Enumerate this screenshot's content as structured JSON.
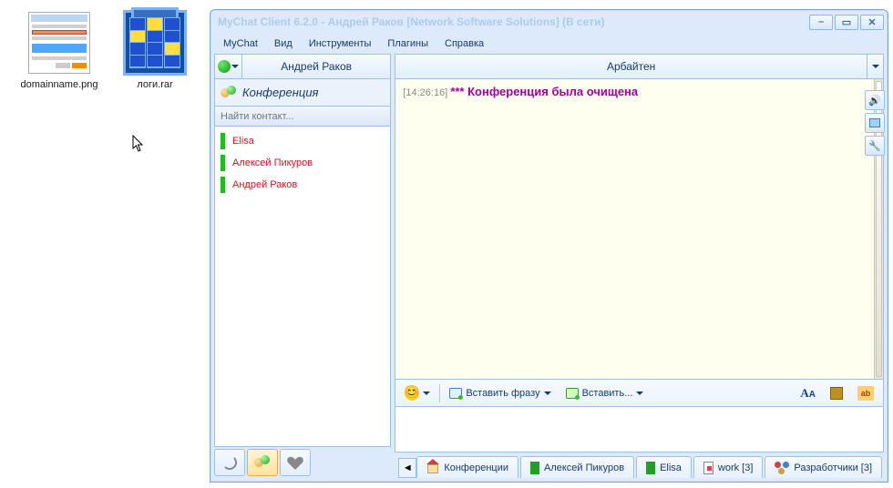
{
  "desktop": {
    "icons": [
      {
        "label": "domainname.png"
      },
      {
        "label": "логи.rar"
      }
    ]
  },
  "window": {
    "title": "MyChat Client 6.2.0 - Андрей Раков [Network Software Solutions] (В сети)",
    "menu": [
      "MyChat",
      "Вид",
      "Инструменты",
      "Плагины",
      "Справка"
    ],
    "user": "Андрей Раков",
    "conference_label": "Конференция",
    "search_placeholder": "Найти контакт...",
    "contacts": [
      "Elisa",
      "Алексей Пикуров",
      "Андрей Раков"
    ],
    "channel": "Арбайтен",
    "message": {
      "time": "[14:26:16]",
      "text": "*** Конференция была очищена"
    },
    "toolbar": {
      "insert_phrase": "Вставить фразу",
      "insert": "Вставить..."
    },
    "bottom_tabs": {
      "conf": "Конференции",
      "user1": "Алексей Пикуров",
      "user2": "Elisa",
      "work": "work [3]",
      "dev": "Разработчики [3]"
    }
  }
}
